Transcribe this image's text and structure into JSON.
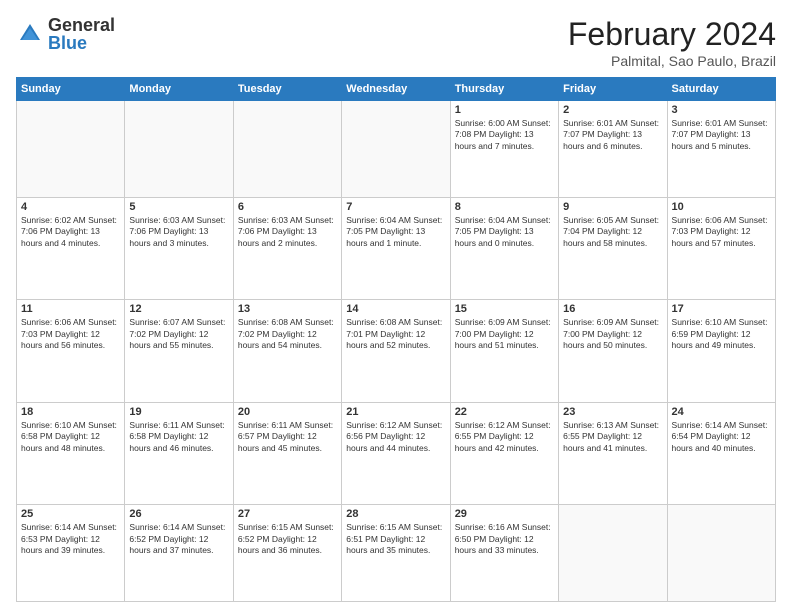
{
  "logo": {
    "general": "General",
    "blue": "Blue"
  },
  "header": {
    "month_year": "February 2024",
    "location": "Palmital, Sao Paulo, Brazil"
  },
  "weekdays": [
    "Sunday",
    "Monday",
    "Tuesday",
    "Wednesday",
    "Thursday",
    "Friday",
    "Saturday"
  ],
  "weeks": [
    [
      {
        "day": "",
        "info": ""
      },
      {
        "day": "",
        "info": ""
      },
      {
        "day": "",
        "info": ""
      },
      {
        "day": "",
        "info": ""
      },
      {
        "day": "1",
        "info": "Sunrise: 6:00 AM\nSunset: 7:08 PM\nDaylight: 13 hours and 7 minutes."
      },
      {
        "day": "2",
        "info": "Sunrise: 6:01 AM\nSunset: 7:07 PM\nDaylight: 13 hours and 6 minutes."
      },
      {
        "day": "3",
        "info": "Sunrise: 6:01 AM\nSunset: 7:07 PM\nDaylight: 13 hours and 5 minutes."
      }
    ],
    [
      {
        "day": "4",
        "info": "Sunrise: 6:02 AM\nSunset: 7:06 PM\nDaylight: 13 hours and 4 minutes."
      },
      {
        "day": "5",
        "info": "Sunrise: 6:03 AM\nSunset: 7:06 PM\nDaylight: 13 hours and 3 minutes."
      },
      {
        "day": "6",
        "info": "Sunrise: 6:03 AM\nSunset: 7:06 PM\nDaylight: 13 hours and 2 minutes."
      },
      {
        "day": "7",
        "info": "Sunrise: 6:04 AM\nSunset: 7:05 PM\nDaylight: 13 hours and 1 minute."
      },
      {
        "day": "8",
        "info": "Sunrise: 6:04 AM\nSunset: 7:05 PM\nDaylight: 13 hours and 0 minutes."
      },
      {
        "day": "9",
        "info": "Sunrise: 6:05 AM\nSunset: 7:04 PM\nDaylight: 12 hours and 58 minutes."
      },
      {
        "day": "10",
        "info": "Sunrise: 6:06 AM\nSunset: 7:03 PM\nDaylight: 12 hours and 57 minutes."
      }
    ],
    [
      {
        "day": "11",
        "info": "Sunrise: 6:06 AM\nSunset: 7:03 PM\nDaylight: 12 hours and 56 minutes."
      },
      {
        "day": "12",
        "info": "Sunrise: 6:07 AM\nSunset: 7:02 PM\nDaylight: 12 hours and 55 minutes."
      },
      {
        "day": "13",
        "info": "Sunrise: 6:08 AM\nSunset: 7:02 PM\nDaylight: 12 hours and 54 minutes."
      },
      {
        "day": "14",
        "info": "Sunrise: 6:08 AM\nSunset: 7:01 PM\nDaylight: 12 hours and 52 minutes."
      },
      {
        "day": "15",
        "info": "Sunrise: 6:09 AM\nSunset: 7:00 PM\nDaylight: 12 hours and 51 minutes."
      },
      {
        "day": "16",
        "info": "Sunrise: 6:09 AM\nSunset: 7:00 PM\nDaylight: 12 hours and 50 minutes."
      },
      {
        "day": "17",
        "info": "Sunrise: 6:10 AM\nSunset: 6:59 PM\nDaylight: 12 hours and 49 minutes."
      }
    ],
    [
      {
        "day": "18",
        "info": "Sunrise: 6:10 AM\nSunset: 6:58 PM\nDaylight: 12 hours and 48 minutes."
      },
      {
        "day": "19",
        "info": "Sunrise: 6:11 AM\nSunset: 6:58 PM\nDaylight: 12 hours and 46 minutes."
      },
      {
        "day": "20",
        "info": "Sunrise: 6:11 AM\nSunset: 6:57 PM\nDaylight: 12 hours and 45 minutes."
      },
      {
        "day": "21",
        "info": "Sunrise: 6:12 AM\nSunset: 6:56 PM\nDaylight: 12 hours and 44 minutes."
      },
      {
        "day": "22",
        "info": "Sunrise: 6:12 AM\nSunset: 6:55 PM\nDaylight: 12 hours and 42 minutes."
      },
      {
        "day": "23",
        "info": "Sunrise: 6:13 AM\nSunset: 6:55 PM\nDaylight: 12 hours and 41 minutes."
      },
      {
        "day": "24",
        "info": "Sunrise: 6:14 AM\nSunset: 6:54 PM\nDaylight: 12 hours and 40 minutes."
      }
    ],
    [
      {
        "day": "25",
        "info": "Sunrise: 6:14 AM\nSunset: 6:53 PM\nDaylight: 12 hours and 39 minutes."
      },
      {
        "day": "26",
        "info": "Sunrise: 6:14 AM\nSunset: 6:52 PM\nDaylight: 12 hours and 37 minutes."
      },
      {
        "day": "27",
        "info": "Sunrise: 6:15 AM\nSunset: 6:52 PM\nDaylight: 12 hours and 36 minutes."
      },
      {
        "day": "28",
        "info": "Sunrise: 6:15 AM\nSunset: 6:51 PM\nDaylight: 12 hours and 35 minutes."
      },
      {
        "day": "29",
        "info": "Sunrise: 6:16 AM\nSunset: 6:50 PM\nDaylight: 12 hours and 33 minutes."
      },
      {
        "day": "",
        "info": ""
      },
      {
        "day": "",
        "info": ""
      }
    ]
  ]
}
